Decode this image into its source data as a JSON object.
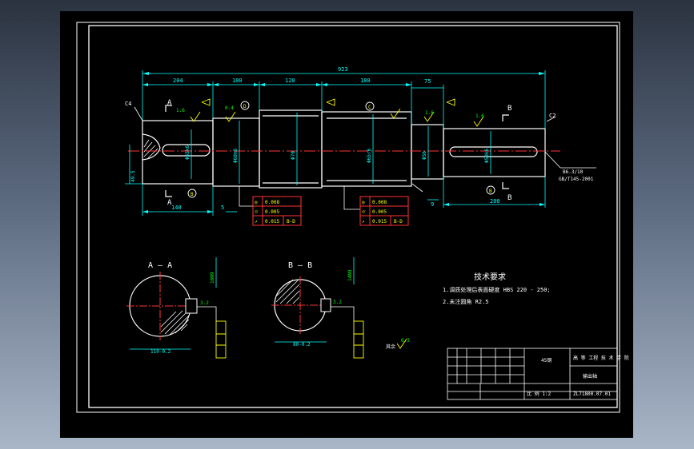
{
  "colors": {
    "background": "#000000",
    "outline": "#ffffff",
    "dimension": "#00ffff",
    "center": "#ff3333",
    "hatch": "#ffffff",
    "datum": "#ffff00",
    "tolerance": "#00ff00",
    "finish": "#ffff00"
  },
  "views": {
    "section_a_label": "A — A",
    "section_b_label": "B — B",
    "cut_a_top": "A",
    "cut_a_bottom": "A",
    "cut_b_top": "B",
    "cut_b_bottom": "B"
  },
  "chamfers": {
    "left": "C4",
    "right": "C2",
    "center_hole": "B6.3/10",
    "center_std": "GB/T145-2001"
  },
  "dims": {
    "overall": "923",
    "seg1": "204",
    "seg2": "100",
    "seg3": "120",
    "seg4": "180",
    "seg5": "75",
    "bottom1": "140",
    "bottom2": "5",
    "bottom3": "9",
    "bottom4": "200",
    "sec_a_width": "110-0.2",
    "sec_b_width": "80-0.2"
  },
  "finish": {
    "f1": "1.6",
    "f2": "1.6",
    "f3": "1.6",
    "f4": "1.6",
    "f5": "0.4",
    "f6": "3.2",
    "f7": "3.2",
    "f8": "3.2",
    "other": "6.3",
    "other_label": "其余"
  },
  "tolerance_frames": {
    "left": [
      {
        "symbol": "◎",
        "value": "0.008",
        "datum": ""
      },
      {
        "symbol": "⌭",
        "value": "0.005",
        "datum": ""
      },
      {
        "symbol": "↗",
        "value": "0.015",
        "datum": "B-D"
      }
    ],
    "right": [
      {
        "symbol": "◎",
        "value": "0.008",
        "datum": ""
      },
      {
        "symbol": "⌭",
        "value": "0.005",
        "datum": ""
      },
      {
        "symbol": "↗",
        "value": "0.015",
        "datum": "B-D"
      }
    ]
  },
  "datums": {
    "d1": "D",
    "d2": "B",
    "d3": "C",
    "d4": "B",
    "d5": "C"
  },
  "tech": {
    "title": "技术要求",
    "line1": "1.调质处理后表面硬度 HBS 220 - 250;",
    "line2": "2.未注圆角 R2.5"
  },
  "title_block": {
    "school": "高 等 工程 技 术 学 院",
    "part_name": "输出轴",
    "material": "45钢",
    "drawing_no": "ZL71800.07.01",
    "scale": "比 例 1:2"
  }
}
